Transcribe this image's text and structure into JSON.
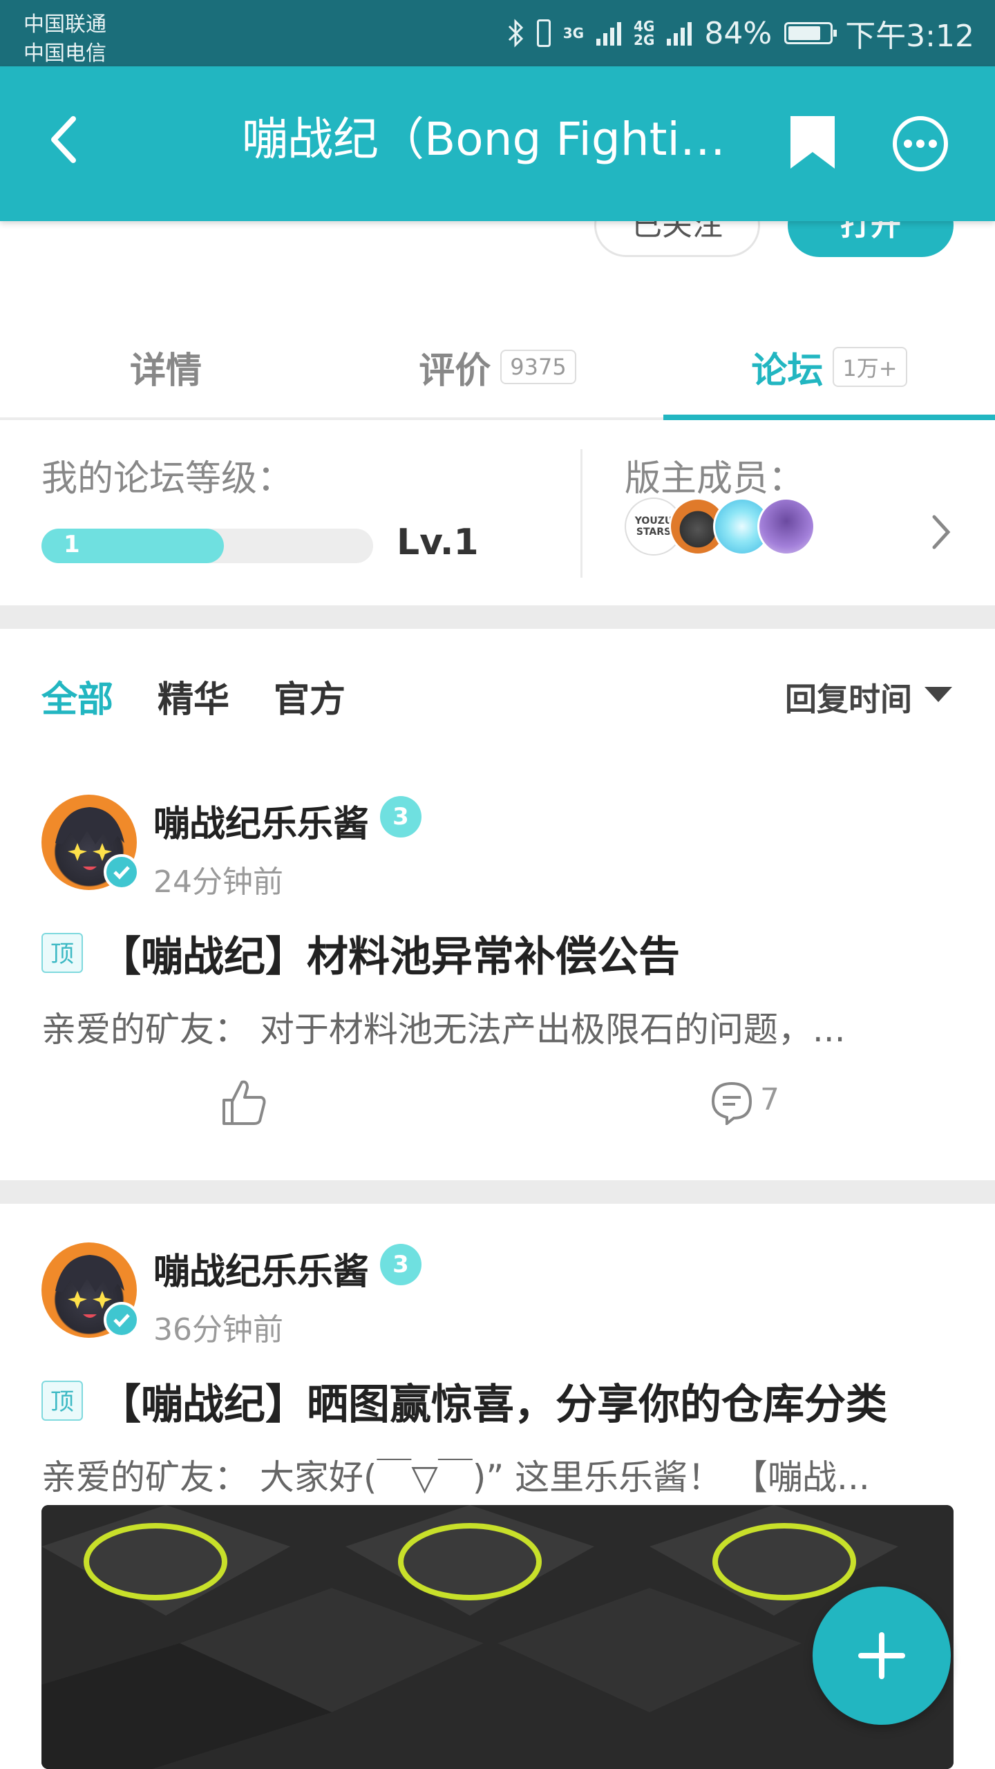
{
  "status_bar": {
    "carrier1": "中国联通",
    "carrier2": "中国电信",
    "net1": "3G",
    "net2a": "4G",
    "net2b": "2G",
    "battery": "84%",
    "time": "下午3:12"
  },
  "appbar": {
    "title": "嘣战纪（Bong Fighting）",
    "back_icon": "back-chevron-icon",
    "bookmark_icon": "bookmark-icon",
    "more_icon": "more-icon"
  },
  "header_buttons": {
    "follow": "已关注",
    "open": "打开"
  },
  "tabs": [
    {
      "label": "详情",
      "count": ""
    },
    {
      "label": "评价",
      "count": "9375"
    },
    {
      "label": "论坛",
      "count": "1万+"
    }
  ],
  "forum_level": {
    "title": "我的论坛等级：",
    "progress_value": "1",
    "progress_fraction": 0.55,
    "level": "Lv.1"
  },
  "moderators": {
    "title": "版主成员：",
    "first_avatar_text": "YOUZU STARS"
  },
  "filters": [
    "全部",
    "精华",
    "官方"
  ],
  "sort": {
    "label": "回复时间"
  },
  "posts": [
    {
      "author": "嘣战纪乐乐酱",
      "level": "3",
      "time": "24分钟前",
      "pin": "顶",
      "title": "【嘣战纪】材料池异常补偿公告",
      "excerpt": "亲爱的矿友：  对于材料池无法产出极限石的问题，...",
      "comments": "7"
    },
    {
      "author": "嘣战纪乐乐酱",
      "level": "3",
      "time": "36分钟前",
      "pin": "顶",
      "title": "【嘣战纪】晒图赢惊喜，分享你的仓库分类",
      "excerpt": "亲爱的矿友：  大家好(￣▽￣)” 这里乐乐酱！  【嘣战..."
    }
  ],
  "colors": {
    "accent": "#22b6c1",
    "status_bar": "#1b6e7a",
    "level_fill": "#6fe0e0"
  }
}
